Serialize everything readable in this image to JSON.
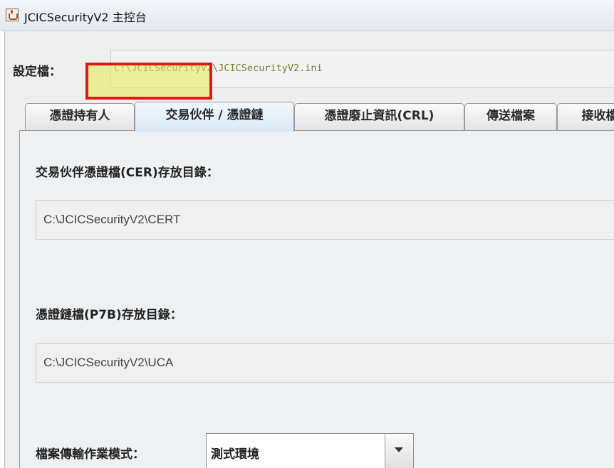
{
  "window": {
    "title": "JCICSecurityV2 主控台",
    "icon": "java-cup-icon"
  },
  "config": {
    "label": "設定檔：",
    "value": "C:\\JCICSecurityV2\\JCICSecurityV2.ini"
  },
  "tabs": [
    {
      "label": "憑證持有人",
      "active": false
    },
    {
      "label": "交易伙伴 / 憑證鏈",
      "active": true
    },
    {
      "label": "憑證廢止資訊(CRL)",
      "active": false
    },
    {
      "label": "傳送檔案",
      "active": false
    },
    {
      "label": "接收檔",
      "active": false
    }
  ],
  "panel": {
    "partner_cert_label": "交易伙伴憑證檔(CER)存放目錄：",
    "partner_cert_path": "C:\\JCICSecurityV2\\CERT",
    "chain_cert_label": "憑證鏈檔(P7B)存放目錄：",
    "chain_cert_path": "C:\\JCICSecurityV2\\UCA",
    "transfer_mode_label": "檔案傳輸作業模式：",
    "transfer_mode_value": "測式環境"
  },
  "colors": {
    "highlight_fill": "#e6ec50",
    "highlight_border": "#e41616",
    "active_tab": "#d9e8f6",
    "config_text": "#7a7a2c"
  }
}
